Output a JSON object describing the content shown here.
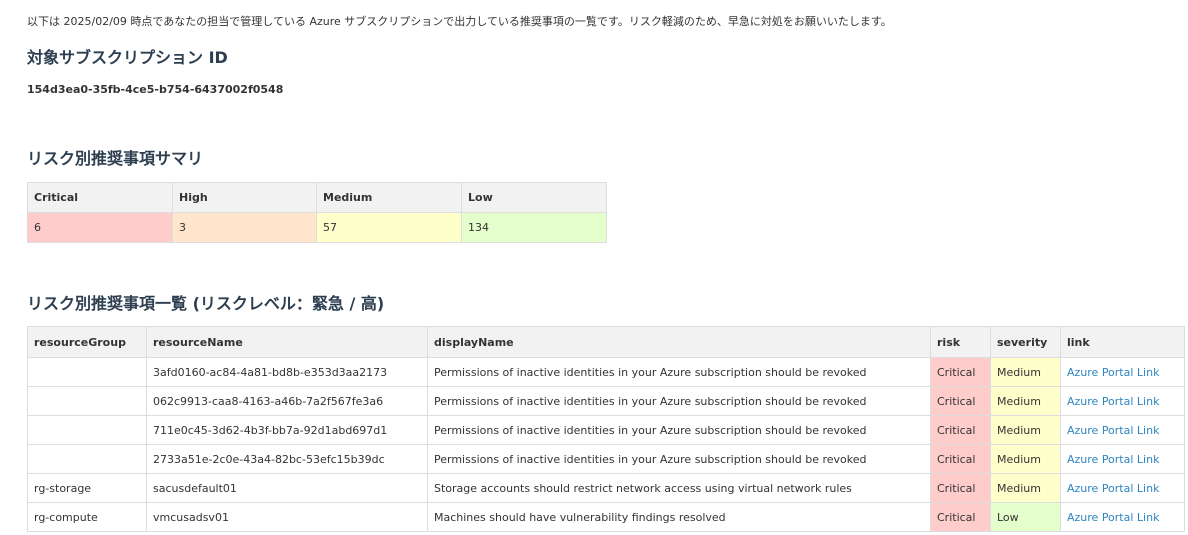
{
  "intro_text": "以下は 2025/02/09 時点であなたの担当で管理している Azure サブスクリプションで出力している推奨事項の一覧です。リスク軽減のため、早急に対処をお願いいたします。",
  "subscription": {
    "heading": "対象サブスクリプション ID",
    "id": "154d3ea0-35fb-4ce5-b754-6437002f0548"
  },
  "summary": {
    "heading": "リスク別推奨事項サマリ",
    "headers": [
      "Critical",
      "High",
      "Medium",
      "Low"
    ],
    "values": [
      "6",
      "3",
      "57",
      "134"
    ],
    "colors": {
      "critical": "#ffcccc",
      "high": "#ffe5cc",
      "medium": "#ffffcc",
      "low": "#e5ffcc"
    }
  },
  "list": {
    "heading": "リスク別推奨事項一覧 (リスクレベル：緊急 / 高)",
    "headers": [
      "resourceGroup",
      "resourceName",
      "displayName",
      "risk",
      "severity",
      "link"
    ],
    "rows": [
      {
        "resourceGroup": "",
        "resourceName": "3afd0160-ac84-4a81-bd8b-e353d3aa2173",
        "displayName": "Permissions of inactive identities in your Azure subscription should be revoked",
        "risk": "Critical",
        "severity": "Medium",
        "link": "Azure Portal Link"
      },
      {
        "resourceGroup": "",
        "resourceName": "062c9913-caa8-4163-a46b-7a2f567fe3a6",
        "displayName": "Permissions of inactive identities in your Azure subscription should be revoked",
        "risk": "Critical",
        "severity": "Medium",
        "link": "Azure Portal Link"
      },
      {
        "resourceGroup": "",
        "resourceName": "711e0c45-3d62-4b3f-bb7a-92d1abd697d1",
        "displayName": "Permissions of inactive identities in your Azure subscription should be revoked",
        "risk": "Critical",
        "severity": "Medium",
        "link": "Azure Portal Link"
      },
      {
        "resourceGroup": "",
        "resourceName": "2733a51e-2c0e-43a4-82bc-53efc15b39dc",
        "displayName": "Permissions of inactive identities in your Azure subscription should be revoked",
        "risk": "Critical",
        "severity": "Medium",
        "link": "Azure Portal Link"
      },
      {
        "resourceGroup": "rg-storage",
        "resourceName": "sacusdefault01",
        "displayName": "Storage accounts should restrict network access using virtual network rules",
        "risk": "Critical",
        "severity": "Medium",
        "link": "Azure Portal Link"
      },
      {
        "resourceGroup": "rg-compute",
        "resourceName": "vmcusadsv01",
        "displayName": "Machines should have vulnerability findings resolved",
        "risk": "Critical",
        "severity": "Low",
        "link": "Azure Portal Link"
      }
    ]
  },
  "link_color": "#2e86c1"
}
